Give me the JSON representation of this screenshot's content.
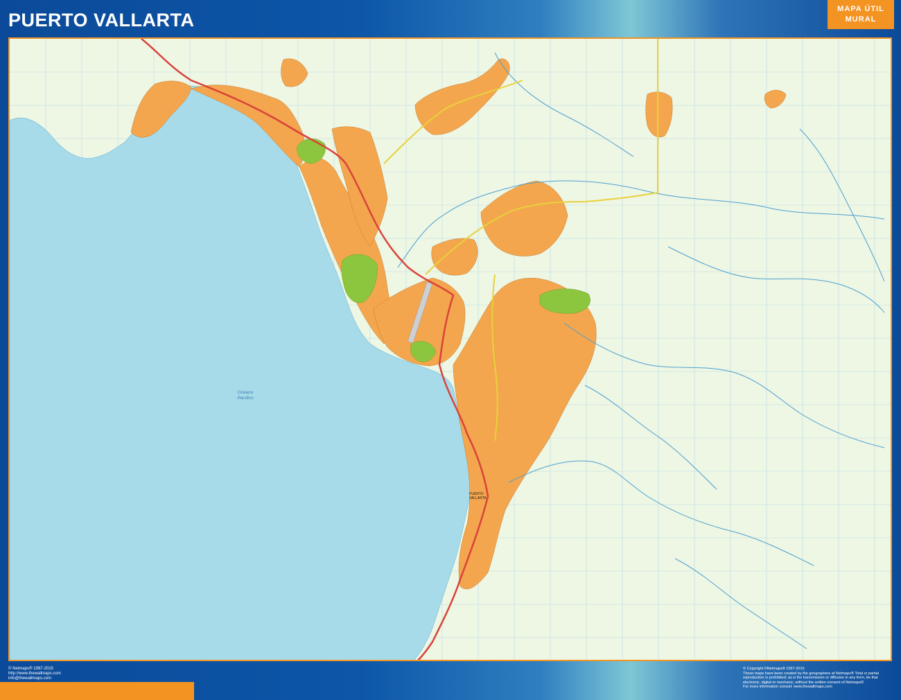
{
  "header": {
    "title": "PUERTO VALLARTA",
    "badge_line1": "MAPA ÚTIL",
    "badge_line2": "MURAL"
  },
  "map": {
    "ocean_label_line1": "Océano",
    "ocean_label_line2": "Pacífico",
    "city_label_line1": "PUERTO",
    "city_label_line2": "VALLARTA",
    "colors": {
      "sea": "#a8dbe9",
      "land": "#eef6e4",
      "urban": "#f3a64e",
      "park": "#8cc63f",
      "main_road": "#d9423a",
      "secondary_road": "#e8d23a",
      "river": "#4aa0d0",
      "grid": "#b9dbe6",
      "frame_orange": "#f39322"
    }
  },
  "footer": {
    "left_line1": "© Netmaps® 1997-2015",
    "left_line2": "http://www.thewallmaps.com",
    "left_line3": "info@thewallmaps.com",
    "right_line1": "© Copyright ©Netmaps® 1997-2015",
    "right_line2": "These maps have been created by the geographers at Netmaps® Total or partial",
    "right_line3": "reproduction is prohibited; as is the transmission or diffusion in any form, be that",
    "right_line4": "electronic, digital or mechanic; without the written consent of Netmaps®",
    "right_line5": "For more information consult: www.thewallmaps.com"
  }
}
